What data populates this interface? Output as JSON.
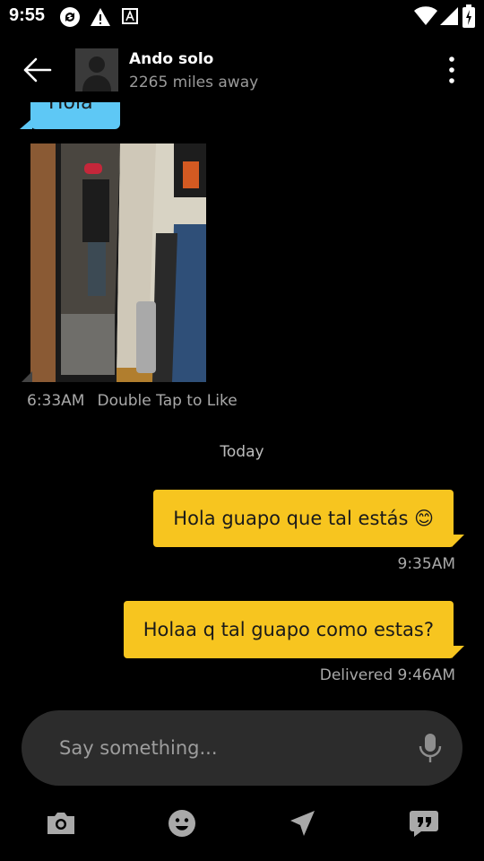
{
  "status_bar": {
    "time": "9:55",
    "icons": [
      "sync-icon",
      "warning-icon",
      "text-a-icon",
      "wifi-icon",
      "signal-icon",
      "battery-icon"
    ]
  },
  "header": {
    "back_icon": "arrow-left-icon",
    "name": "Ando solo",
    "distance": "2265 miles away",
    "more_icon": "more-vertical-icon"
  },
  "messages": {
    "partial_bubble_text": "Hola",
    "photo_time": "6:33AM",
    "photo_like_hint": "Double Tap to Like",
    "date_divider": "Today",
    "sent": [
      {
        "text": "Hola guapo que tal estás 😊",
        "meta": "9:35AM"
      },
      {
        "text": "Holaa q tal guapo como estas?",
        "meta": "Delivered 9:46AM"
      }
    ]
  },
  "composer": {
    "placeholder": "Say something...",
    "mic_icon": "microphone-icon"
  },
  "toolbar": {
    "icons": [
      "camera-icon",
      "emoji-icon",
      "send-location-icon",
      "saved-phrases-icon"
    ]
  },
  "colors": {
    "background": "#000000",
    "sent_bubble": "#f7c51f",
    "received_bubble": "#5ec8f5",
    "composer_bg": "#2c2c2c",
    "secondary_text": "#a9a9a9"
  }
}
